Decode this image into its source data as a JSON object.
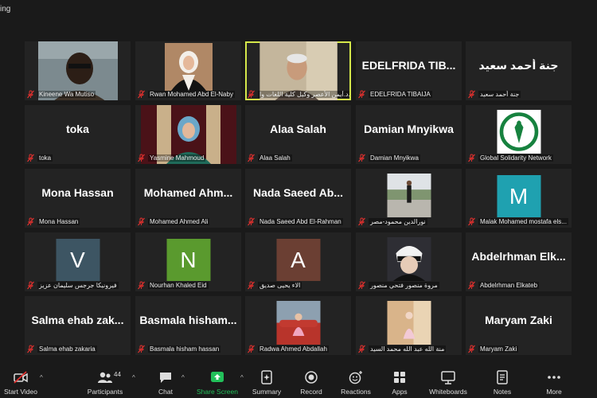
{
  "top_label": "ing",
  "tiles": [
    {
      "label": "Kineene Wa Mutiso",
      "kind": "photo",
      "photo": "man",
      "active": false
    },
    {
      "label": "Rwan Mohamed Abd El-Naby",
      "kind": "photo",
      "photo": "hijab_white"
    },
    {
      "label": "أ.د.أيمن الأعصر وكيل كلية اللغات وا",
      "kind": "photo",
      "photo": "old_man",
      "active": true
    },
    {
      "label": "EDELFRIDA TIBAIJA",
      "kind": "name",
      "display": "EDELFRIDA TIB..."
    },
    {
      "label": "جنة أحمد سعيد",
      "kind": "name",
      "display": "جنة أحمد سعيد"
    },
    {
      "label": "toka",
      "kind": "name",
      "display": "toka"
    },
    {
      "label": "Yasmine Mahmoud",
      "kind": "photo",
      "photo": "hijab_blue"
    },
    {
      "label": "Alaa Salah",
      "kind": "name",
      "display": "Alaa Salah"
    },
    {
      "label": "Damian Mnyikwa",
      "kind": "name",
      "display": "Damian Mnyikwa"
    },
    {
      "label": "Global Solidarity Network",
      "kind": "photo",
      "photo": "logo"
    },
    {
      "label": "Mona Hassan",
      "kind": "name",
      "display": "Mona Hassan"
    },
    {
      "label": "Mohamed Ahmed Ali",
      "kind": "name",
      "display": "Mohamed Ahm..."
    },
    {
      "label": "Nada Saeed Abd El-Rahman",
      "kind": "name",
      "display": "Nada Saeed Ab..."
    },
    {
      "label": "نورالدين محمود-مصر",
      "kind": "photo",
      "photo": "street"
    },
    {
      "label": "Malak Mohamed mostafa els...",
      "kind": "avatar",
      "letter": "M",
      "color": "#1fa1b0"
    },
    {
      "label": "فيرونيكا جرجس سليمان عزيز",
      "kind": "avatar",
      "letter": "V",
      "color": "#3d5563"
    },
    {
      "label": "Nourhan Khaled Eid",
      "kind": "avatar",
      "letter": "N",
      "color": "#5a9a2e"
    },
    {
      "label": "الاء يحيى صديق",
      "kind": "avatar",
      "letter": "A",
      "color": "#6b3f33"
    },
    {
      "label": "مروة منصور فتحي منصور",
      "kind": "photo",
      "photo": "anime"
    },
    {
      "label": "Abdelrhman Elkateb",
      "kind": "name",
      "display": "Abdelrhman Elk..."
    },
    {
      "label": "Salma ehab zakaria",
      "kind": "name",
      "display": "Salma ehab zak..."
    },
    {
      "label": "Basmala hisham hassan",
      "kind": "name",
      "display": "Basmala hisham..."
    },
    {
      "label": "Radwa Ahmed Abdallah",
      "kind": "photo",
      "photo": "car"
    },
    {
      "label": "منة الله عبد الله محمد السيد",
      "kind": "photo",
      "photo": "girl_room"
    },
    {
      "label": "Maryam Zaki",
      "kind": "name",
      "display": "Maryam Zaki"
    }
  ],
  "toolbar": {
    "start_video": "Start Video",
    "participants": "Participants",
    "participants_count": "44",
    "chat": "Chat",
    "share_screen": "Share Screen",
    "summary": "Summary",
    "record": "Record",
    "reactions": "Reactions",
    "apps": "Apps",
    "whiteboards": "Whiteboards",
    "notes": "Notes",
    "more": "More"
  },
  "colors": {
    "active_border": "#d5e84a",
    "share_green": "#22c05a",
    "muted_red": "#e0302e"
  }
}
